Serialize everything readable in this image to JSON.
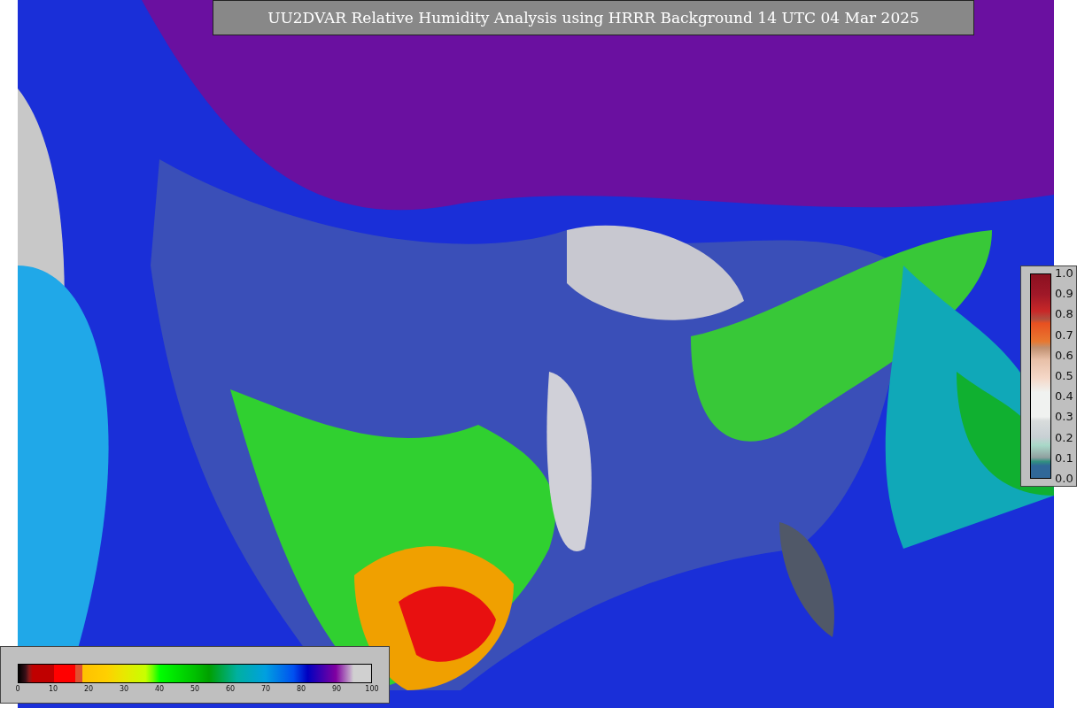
{
  "title": "UU2DVAR Relative Humidity Analysis using HRRR Background 14 UTC 04 Mar 2025",
  "humidity_scale": {
    "ticks": [
      "0",
      "10",
      "20",
      "30",
      "40",
      "50",
      "60",
      "70",
      "80",
      "90",
      "100"
    ]
  },
  "observation_scale": {
    "ticks": [
      "1.0",
      "0.9",
      "0.8",
      "0.7",
      "0.6",
      "0.5",
      "0.4",
      "0.3",
      "0.2",
      "0.1",
      "0.0"
    ]
  }
}
